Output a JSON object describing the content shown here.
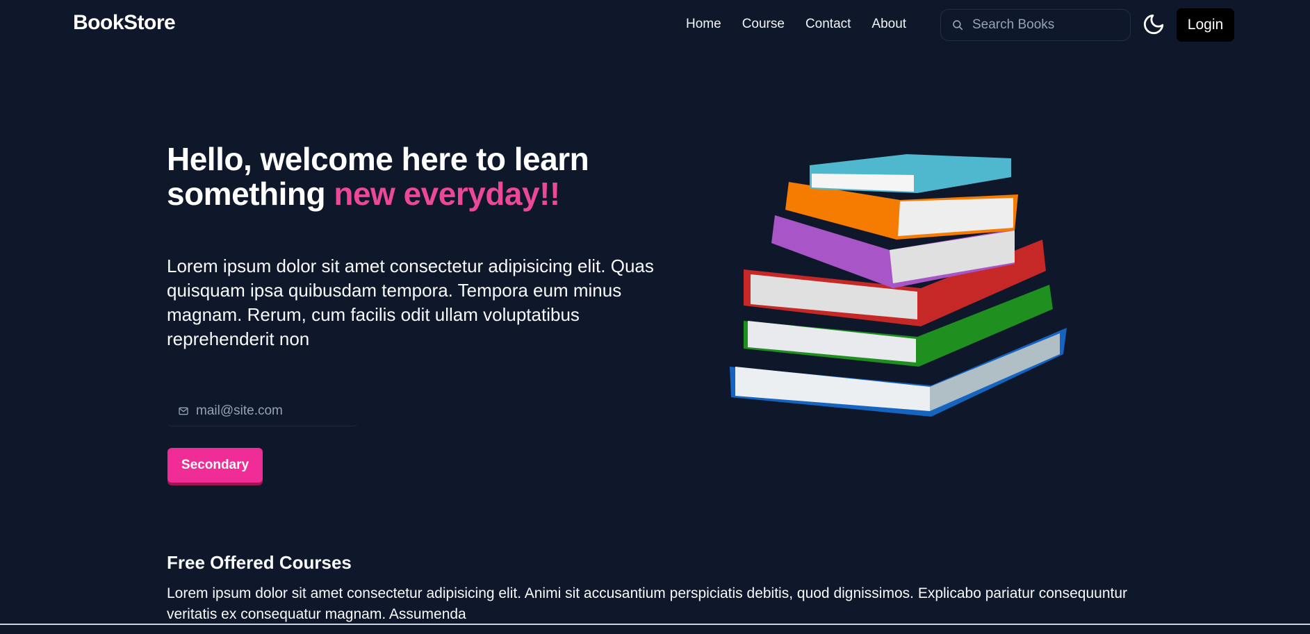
{
  "navbar": {
    "brand": "BookStore",
    "links": [
      "Home",
      "Course",
      "Contact",
      "About"
    ],
    "search_placeholder": "Search Books",
    "login_label": "Login"
  },
  "hero": {
    "title_part1": "Hello, welcome here to learn something ",
    "title_accent": "new everyday!!",
    "description": "Lorem ipsum dolor sit amet consectetur adipisicing elit. Quas quisquam ipsa quibusdam tempora. Tempora eum minus magnam. Rerum, cum facilis odit ullam voluptatibus reprehenderit non",
    "email_placeholder": "mail@site.com",
    "button_label": "Secondary"
  },
  "courses": {
    "title": "Free Offered Courses",
    "description": "Lorem ipsum dolor sit amet consectetur adipisicing elit. Animi sit accusantium perspiciatis debitis, quod dignissimos. Explicabo pariatur consequuntur veritatis ex consequatur magnam. Assumenda"
  },
  "colors": {
    "background": "#0f172a",
    "accent": "#ec4899",
    "button": "#f02c97"
  },
  "icons": {
    "search": "search-icon",
    "theme": "moon-icon",
    "email": "mail-icon",
    "hero_image": "books-stack-image"
  }
}
